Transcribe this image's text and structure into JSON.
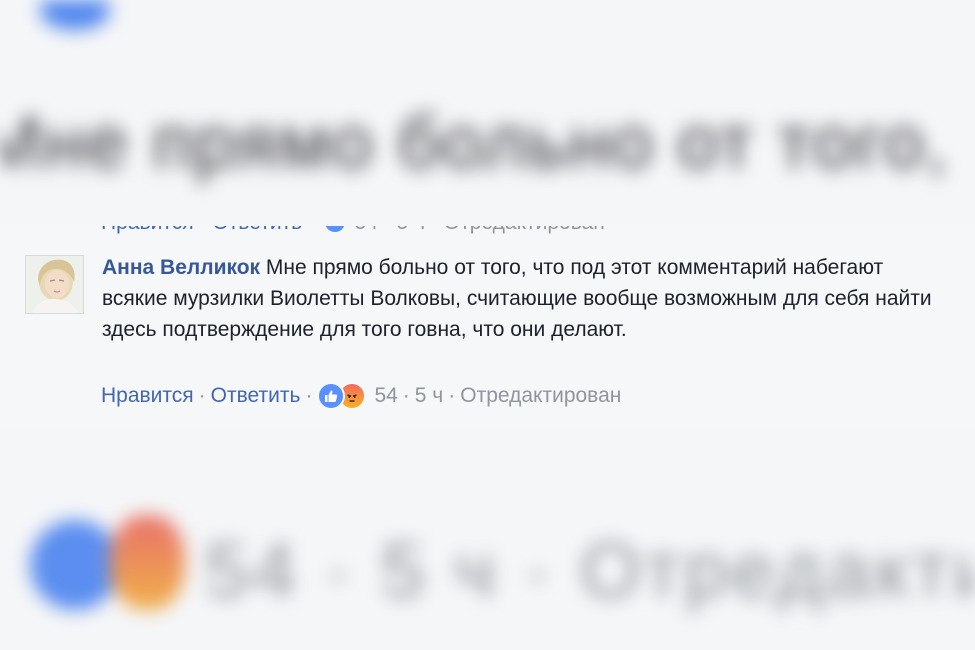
{
  "comment": {
    "author": "Анна Велликок",
    "text": "Мне прямо больно от того, что под этот комментарий набегают всякие мурзилки Виолетты Волковы, считающие вообще возможным для себя найти здесь подтверждение для того говна, что они делают.",
    "actions": {
      "like_label": "Нравится",
      "reply_label": "Ответить",
      "reaction_count": "54",
      "time": "5 ч",
      "edited_label": "Отредактирован",
      "separator": "·",
      "reactions": [
        "like-icon",
        "angry-icon"
      ]
    }
  },
  "previous_comment": {
    "like_label": "Нравится",
    "reply_label": "Ответить",
    "reaction_count": "54",
    "time": "5 ч",
    "edited_label": "Отредактирован"
  },
  "colors": {
    "background": "#f6f7f9",
    "link": "#4267b2",
    "author": "#365899",
    "text": "#1d2129",
    "meta": "#90949c",
    "like": "#5890ff"
  }
}
